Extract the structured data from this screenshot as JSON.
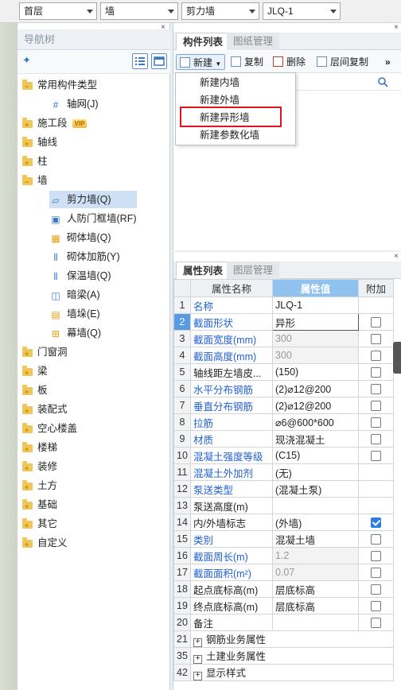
{
  "topbar": {
    "floor": "首层",
    "category": "墙",
    "type": "剪力墙",
    "component": "JLQ-1"
  },
  "nav": {
    "title": "导航树",
    "close": "×",
    "items": [
      {
        "label": "常用构件类型",
        "kind": "folder-open"
      },
      {
        "label": "轴网(J)",
        "kind": "leaf",
        "icon": "grid-icon"
      },
      {
        "label": "施工段",
        "kind": "folder",
        "badge": "VIP"
      },
      {
        "label": "轴线",
        "kind": "folder"
      },
      {
        "label": "柱",
        "kind": "folder"
      },
      {
        "label": "墙",
        "kind": "folder-open"
      },
      {
        "label": "剪力墙(Q)",
        "kind": "leaf",
        "icon": "shear-wall-icon",
        "selected": true
      },
      {
        "label": "人防门框墙(RF)",
        "kind": "leaf",
        "icon": "door-frame-wall-icon"
      },
      {
        "label": "砌体墙(Q)",
        "kind": "leaf",
        "icon": "masonry-wall-icon"
      },
      {
        "label": "砌体加筋(Y)",
        "kind": "leaf",
        "icon": "masonry-rebar-icon"
      },
      {
        "label": "保温墙(Q)",
        "kind": "leaf",
        "icon": "insulation-wall-icon"
      },
      {
        "label": "暗梁(A)",
        "kind": "leaf",
        "icon": "hidden-beam-icon"
      },
      {
        "label": "墙垛(E)",
        "kind": "leaf",
        "icon": "wall-pier-icon"
      },
      {
        "label": "幕墙(Q)",
        "kind": "leaf",
        "icon": "curtain-wall-icon"
      },
      {
        "label": "门窗洞",
        "kind": "folder"
      },
      {
        "label": "梁",
        "kind": "folder"
      },
      {
        "label": "板",
        "kind": "folder"
      },
      {
        "label": "装配式",
        "kind": "folder"
      },
      {
        "label": "空心楼盖",
        "kind": "folder"
      },
      {
        "label": "楼梯",
        "kind": "folder"
      },
      {
        "label": "装修",
        "kind": "folder"
      },
      {
        "label": "土方",
        "kind": "folder"
      },
      {
        "label": "基础",
        "kind": "folder"
      },
      {
        "label": "其它",
        "kind": "folder"
      },
      {
        "label": "自定义",
        "kind": "folder"
      }
    ]
  },
  "component_panel": {
    "tabs": [
      "构件列表",
      "图纸管理"
    ],
    "toolbar": {
      "new": "新建",
      "copy": "复制",
      "delete": "删除",
      "floor_copy": "层间复制",
      "more": "»"
    },
    "menu": [
      "新建内墙",
      "新建外墙",
      "新建异形墙",
      "新建参数化墙"
    ]
  },
  "properties": {
    "tabs": [
      "属性列表",
      "图层管理"
    ],
    "headers": {
      "name": "属性名称",
      "value": "属性值",
      "extra": "附加"
    },
    "rows": [
      {
        "n": "1",
        "name": "名称",
        "value": "JLQ-1",
        "style": "blue",
        "check": null
      },
      {
        "n": "2",
        "name": "截面形状",
        "value": "异形",
        "style": "blue",
        "check": false,
        "editing": true,
        "selected": true
      },
      {
        "n": "3",
        "name": "截面宽度(mm)",
        "value": "300",
        "style": "blue",
        "check": false,
        "gray": true
      },
      {
        "n": "4",
        "name": "截面高度(mm)",
        "value": "300",
        "style": "blue",
        "check": false,
        "gray": true
      },
      {
        "n": "5",
        "name": "轴线距左墙皮...",
        "value": "(150)",
        "style": "black",
        "check": false
      },
      {
        "n": "6",
        "name": "水平分布钢筋",
        "value": "(2)⌀12@200",
        "style": "blue",
        "check": false
      },
      {
        "n": "7",
        "name": "垂直分布钢筋",
        "value": "(2)⌀12@200",
        "style": "blue",
        "check": false
      },
      {
        "n": "8",
        "name": "拉筋",
        "value": "⌀6@600*600",
        "style": "blue",
        "check": false
      },
      {
        "n": "9",
        "name": "材质",
        "value": "现浇混凝土",
        "style": "blue",
        "check": false
      },
      {
        "n": "10",
        "name": "混凝土强度等级",
        "value": "(C15)",
        "style": "blue",
        "check": false
      },
      {
        "n": "11",
        "name": "混凝土外加剂",
        "value": "(无)",
        "style": "blue",
        "check": null
      },
      {
        "n": "12",
        "name": "泵送类型",
        "value": "(混凝土泵)",
        "style": "blue",
        "check": null
      },
      {
        "n": "13",
        "name": "泵送高度(m)",
        "value": "",
        "style": "black",
        "check": null
      },
      {
        "n": "14",
        "name": "内/外墙标志",
        "value": "(外墙)",
        "style": "black",
        "check": true
      },
      {
        "n": "15",
        "name": "类别",
        "value": "混凝土墙",
        "style": "blue",
        "check": false
      },
      {
        "n": "16",
        "name": "截面周长(m)",
        "value": "1.2",
        "style": "blue",
        "check": false,
        "gray": true
      },
      {
        "n": "17",
        "name": "截面面积(m²)",
        "value": "0.07",
        "style": "blue",
        "check": false,
        "gray": true
      },
      {
        "n": "18",
        "name": "起点底标高(m)",
        "value": "层底标高",
        "style": "black",
        "check": false
      },
      {
        "n": "19",
        "name": "终点底标高(m)",
        "value": "层底标高",
        "style": "black",
        "check": false
      },
      {
        "n": "20",
        "name": "备注",
        "value": "",
        "style": "black",
        "check": false
      }
    ],
    "groups": [
      {
        "n": "21",
        "name": "钢筋业务属性"
      },
      {
        "n": "35",
        "name": "土建业务属性"
      },
      {
        "n": "42",
        "name": "显示样式"
      }
    ]
  }
}
